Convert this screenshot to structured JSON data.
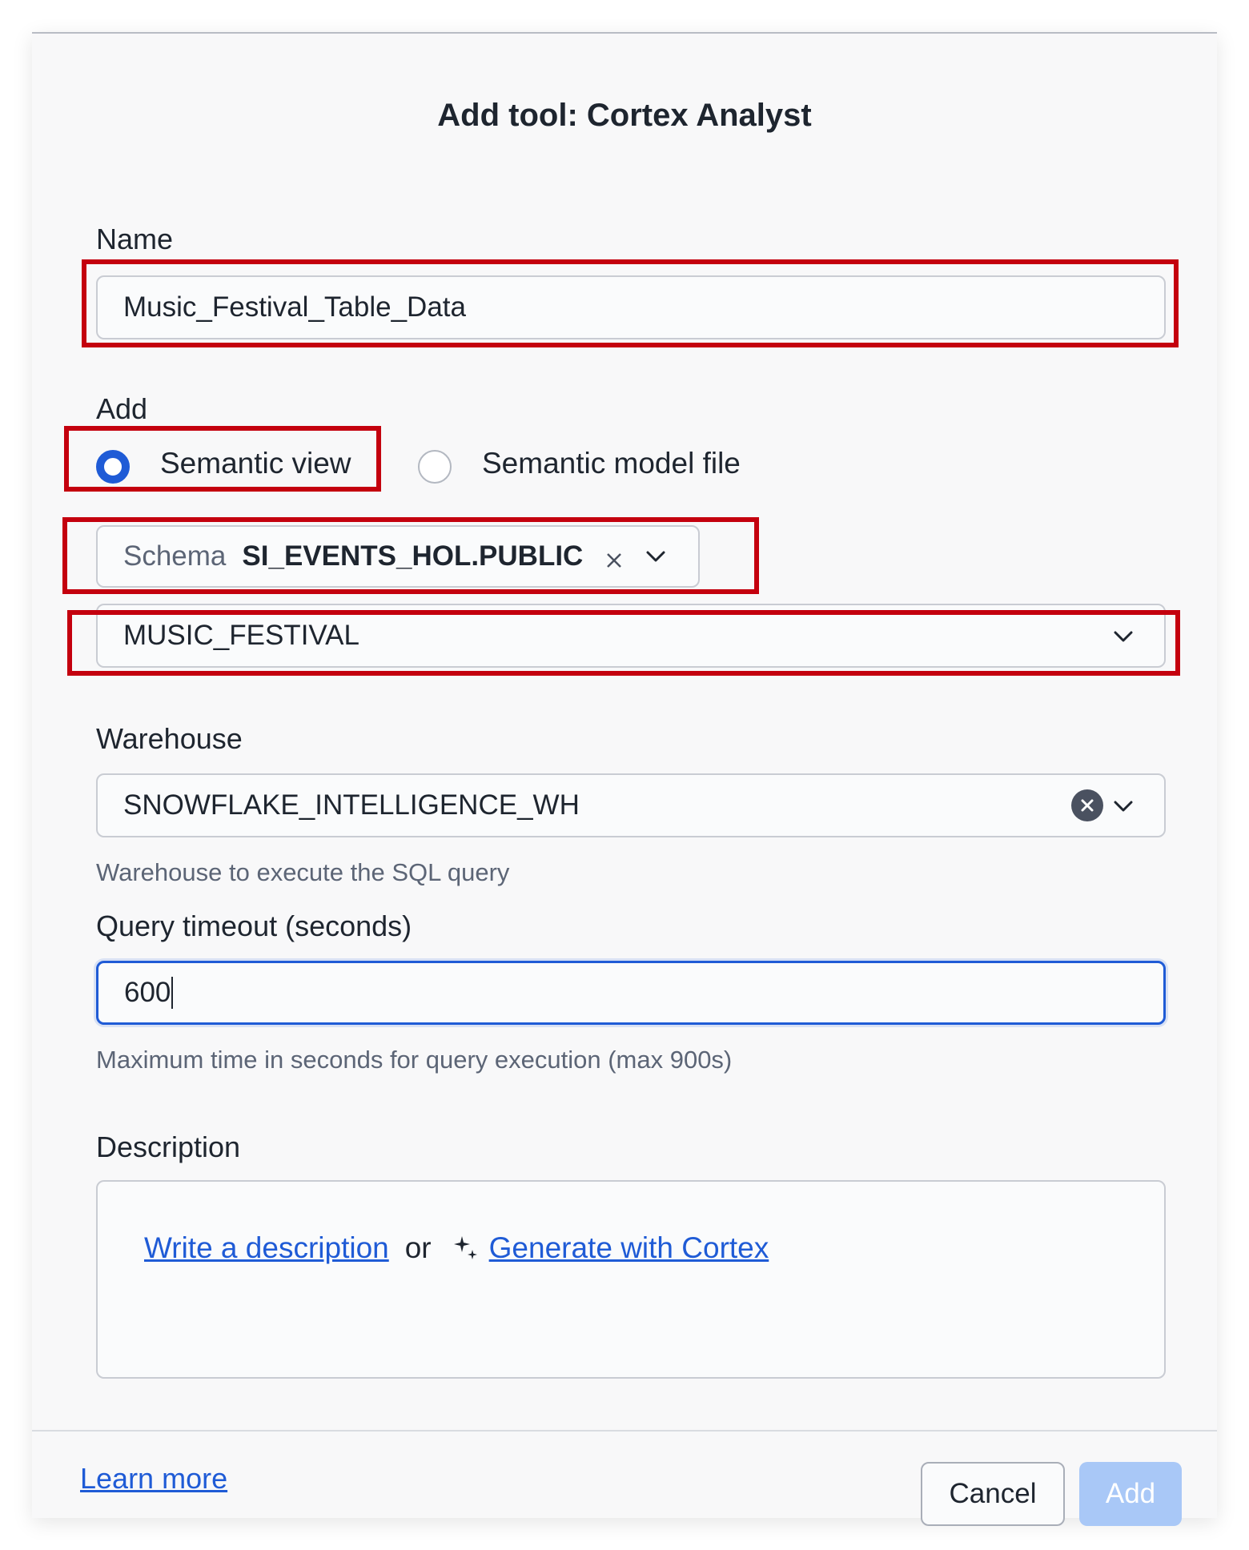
{
  "dialog": {
    "title": "Add tool: Cortex Analyst"
  },
  "name_field": {
    "label": "Name",
    "value": "Music_Festival_Table_Data"
  },
  "add_section": {
    "label": "Add",
    "options": [
      {
        "label": "Semantic view",
        "selected": true
      },
      {
        "label": "Semantic model file",
        "selected": false
      }
    ]
  },
  "schema_select": {
    "prefix": "Schema",
    "value": "SI_EVENTS_HOL.PUBLIC",
    "clear_icon": "close-icon",
    "dropdown_icon": "chevron-down-icon"
  },
  "semantic_view_select": {
    "value": "MUSIC_FESTIVAL",
    "dropdown_icon": "chevron-down-icon"
  },
  "warehouse": {
    "label": "Warehouse",
    "value": "SNOWFLAKE_INTELLIGENCE_WH",
    "hint": "Warehouse to execute the SQL query"
  },
  "query_timeout": {
    "label": "Query timeout (seconds)",
    "value": "600",
    "hint": "Maximum time in seconds for query execution (max 900s)"
  },
  "description": {
    "label": "Description",
    "write_link": "Write a description",
    "or_text": "or",
    "generate_link": "Generate with Cortex",
    "sparkle_icon": "sparkle-icon"
  },
  "footer": {
    "learn_more": "Learn more",
    "cancel_label": "Cancel",
    "add_label": "Add"
  },
  "colors": {
    "accent": "#1f5bd6",
    "highlight_box": "#c4000e",
    "add_button_disabled": "#a9c8f7"
  }
}
